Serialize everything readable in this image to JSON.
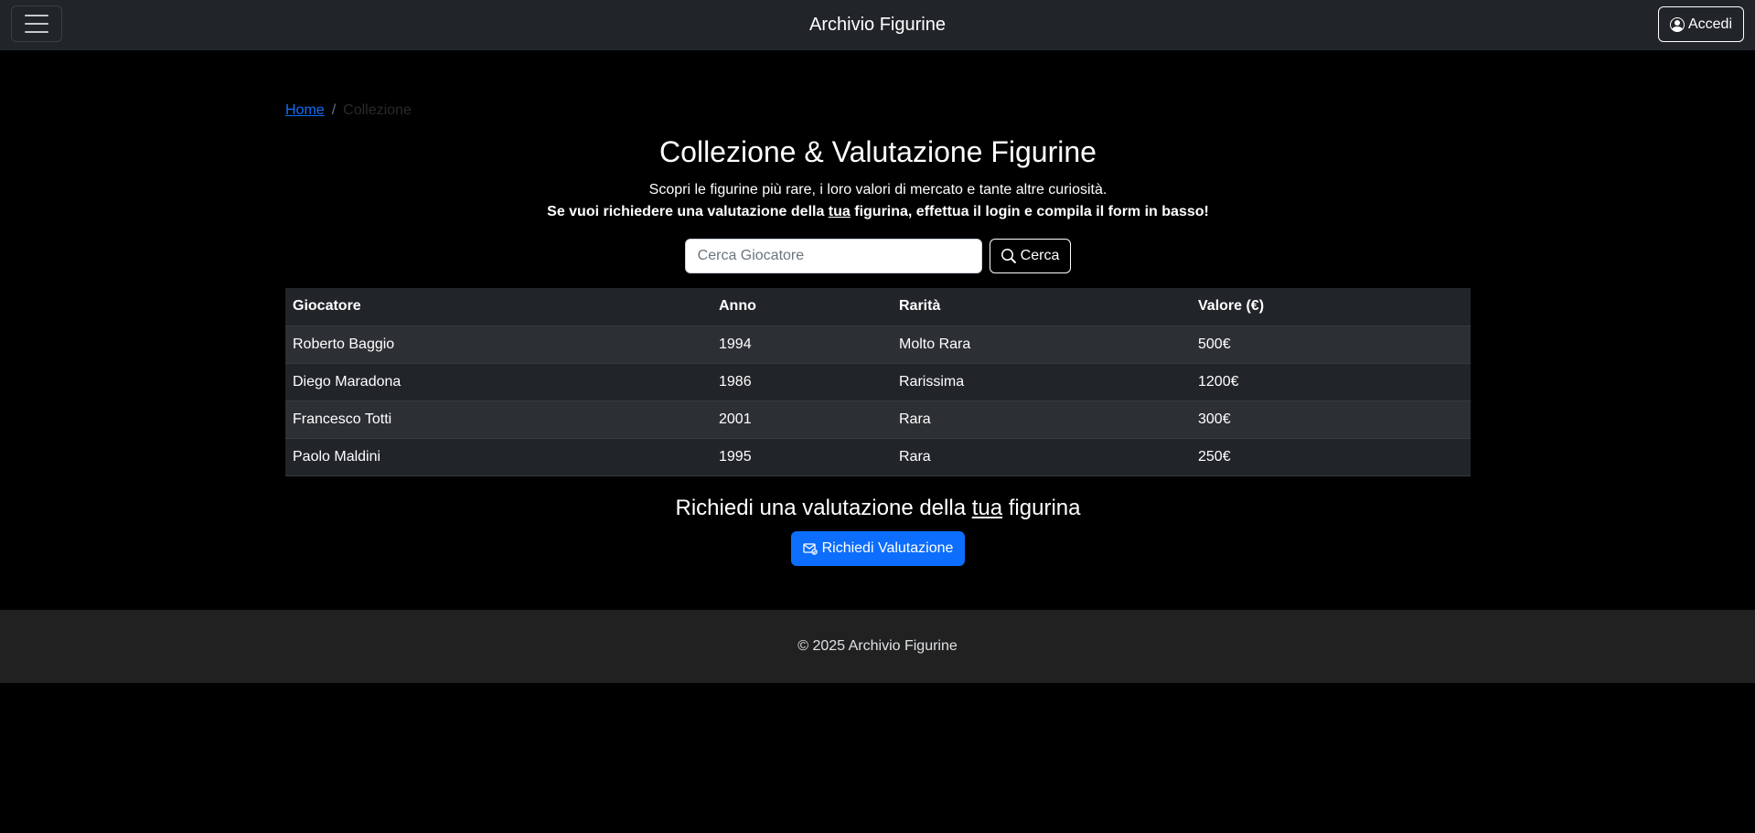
{
  "navbar": {
    "brand": "Archivio Figurine",
    "login_label": "Accedi"
  },
  "breadcrumb": {
    "home": "Home",
    "separator": "/",
    "current": "Collezione"
  },
  "header": {
    "title": "Collezione & Valutazione Figurine",
    "subtitle": "Scopri le figurine più rare, i loro valori di mercato e tante altre curiosità.",
    "bold_part1": "Se vuoi richiedere una valutazione della ",
    "bold_underlined": "tua",
    "bold_part2": " figurina, effettua il login e compila il form in basso!"
  },
  "search": {
    "placeholder": "Cerca Giocatore",
    "value": "",
    "button_label": "Cerca"
  },
  "table": {
    "headers": [
      "Giocatore",
      "Anno",
      "Rarità",
      "Valore (€)"
    ],
    "rows": [
      [
        "Roberto Baggio",
        "1994",
        "Molto Rara",
        "500€"
      ],
      [
        "Diego Maradona",
        "1986",
        "Rarissima",
        "1200€"
      ],
      [
        "Francesco Totti",
        "2001",
        "Rara",
        "300€"
      ],
      [
        "Paolo Maldini",
        "1995",
        "Rara",
        "250€"
      ]
    ]
  },
  "request_section": {
    "title_part1": "Richiedi una valutazione della ",
    "title_underlined": "tua",
    "title_part2": " figurina",
    "button_label": "Richiedi Valutazione"
  },
  "footer": {
    "text": "© 2025 Archivio Figurine"
  },
  "icons": {
    "menu": "hamburger-icon",
    "login": "person-circle-icon",
    "search": "search-icon",
    "request": "envelope-icon"
  },
  "colors": {
    "background": "#000000",
    "navbar": "#212529",
    "primary": "#0d6efd",
    "footer": "#212121"
  }
}
